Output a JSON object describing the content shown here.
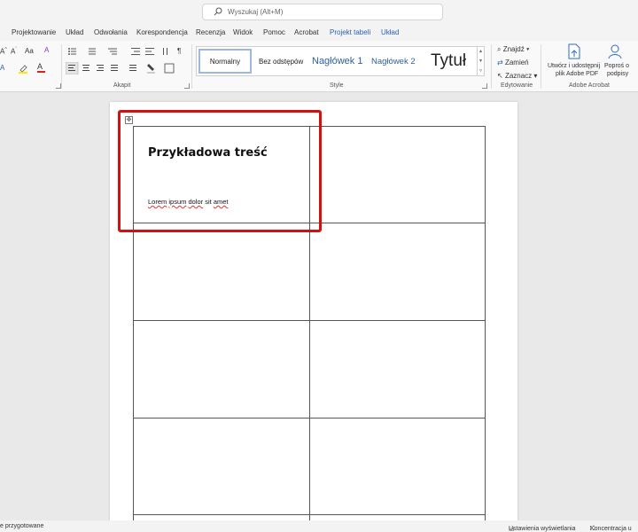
{
  "search": {
    "placeholder": "Wyszukaj (Alt+M)"
  },
  "tabs": [
    {
      "label": "Projektowanie"
    },
    {
      "label": "Układ"
    },
    {
      "label": "Odwołania"
    },
    {
      "label": "Korespondencja"
    },
    {
      "label": "Recenzja"
    },
    {
      "label": "Widok"
    },
    {
      "label": "Pomoc"
    },
    {
      "label": "Acrobat"
    },
    {
      "label": "Projekt tabeli"
    },
    {
      "label": "Układ"
    }
  ],
  "ribbon": {
    "font_aa": "Aa",
    "paragraph_mark": "¶",
    "groups": {
      "paragraph": "Akapit",
      "styles": "Style",
      "editing": "Edytowanie",
      "acrobat": "Adobe Acrobat"
    },
    "styles": {
      "normal": "Normalny",
      "no_spacing": "Bez odstępów",
      "heading1": "Nagłówek 1",
      "heading2": "Nagłówek 2",
      "title": "Tytuł"
    },
    "editing": {
      "find": "Znajdź",
      "replace": "Zamień",
      "select": "Zaznacz"
    },
    "acrobat": {
      "create_pdf_line1": "Utwórz i udostępnij",
      "create_pdf_line2": "plik Adobe PDF",
      "request_sign_line1": "Poproś o",
      "request_sign_line2": "podpisy"
    }
  },
  "document": {
    "heading": "Przykładowa treść",
    "body_words": [
      "Lorem",
      "ipsum",
      "dolor",
      "sit",
      "amet"
    ]
  },
  "status": {
    "left": "e przygotowane",
    "display_settings": "Ustawienia wyświetlania",
    "focus": "Koncentracja u"
  },
  "colors": {
    "highlight_box": "#d31010",
    "context_tab": "#2b5fb3"
  }
}
